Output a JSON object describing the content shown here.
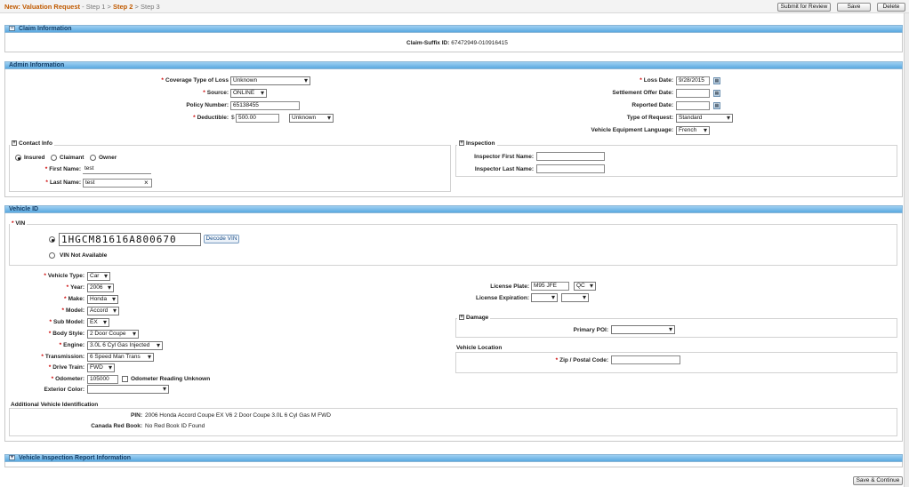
{
  "header": {
    "title": "New: Valuation Request",
    "sep1": " - ",
    "step1": "Step 1",
    "arrow1": " > ",
    "step2": "Step 2",
    "arrow2": " > ",
    "step3": "Step 3",
    "submit_label": "Submit for Review",
    "save_label": "Save",
    "delete_label": "Delete"
  },
  "claim": {
    "title": "Claim Information",
    "toggle": "−",
    "suffix_label": "Claim-Suffix ID:",
    "suffix_value": "67472949-010916415"
  },
  "admin": {
    "title": "Admin Information",
    "coverage_label": "Coverage Type of Loss",
    "coverage_value": "Unknown",
    "source_label": "Source:",
    "source_value": "ONLINE",
    "policy_label": "Policy Number:",
    "policy_value": "65138455",
    "deductible_label": "Deductible:",
    "currency": "$",
    "deductible_value": "500.00",
    "deductible_type": "Unknown",
    "loss_date_label": "Loss Date:",
    "loss_date_value": "9/28/2015",
    "settlement_label": "Settlement Offer Date:",
    "settlement_value": "",
    "reported_label": "Reported Date:",
    "reported_value": "",
    "request_type_label": "Type of Request:",
    "request_type_value": "Standard",
    "equipment_lang_label": "Vehicle Equipment Language:",
    "equipment_lang_value": "French",
    "cal_icon": "▦"
  },
  "contact": {
    "legend": "Contact Info",
    "insured": "Insured",
    "claimant": "Claimant",
    "owner": "Owner",
    "first_name_label": "First Name:",
    "first_name_value": "test",
    "last_name_label": "Last Name:",
    "last_name_value": "test",
    "clear_icon": "×"
  },
  "inspection": {
    "legend": "Inspection",
    "first_name_label": "Inspector First Name:",
    "first_name_value": "",
    "last_name_label": "Inspector Last Name:",
    "last_name_value": ""
  },
  "vehicle": {
    "title": "Vehicle ID",
    "vin_legend": "VIN",
    "vin_value": "1HGCM81616A800670",
    "decode_label": "Decode VIN",
    "vin_na_label": "VIN Not Available",
    "type_label": "Vehicle Type:",
    "type_value": "Car",
    "year_label": "Year:",
    "year_value": "2006",
    "make_label": "Make:",
    "make_value": "Honda",
    "model_label": "Model:",
    "model_value": "Accord",
    "submodel_label": "Sub Model:",
    "submodel_value": "EX",
    "body_label": "Body Style:",
    "body_value": "2 Door Coupe",
    "engine_label": "Engine:",
    "engine_value": "3.0L 6 Cyl Gas Injected",
    "transmission_label": "Transmission:",
    "transmission_value": "6 Speed Man Trans",
    "drivetrain_label": "Drive Train:",
    "drivetrain_value": "FWD",
    "odometer_label": "Odometer:",
    "odometer_value": "105000",
    "odometer_unknown_label": "Odometer Reading Unknown",
    "exterior_label": "Exterior Color:",
    "exterior_value": "",
    "plate_label": "License Plate:",
    "plate_value": "M95 JFE",
    "plate_province": "QC",
    "expiration_label": "License Expiration:",
    "expiration_month": "",
    "expiration_year": "",
    "damage_legend": "Damage",
    "poi_label": "Primary POI:",
    "poi_value": "",
    "location_title": "Vehicle Location",
    "zip_label": "Zip / Postal Code:",
    "zip_value": "",
    "additional_title": "Additional Vehicle Identification",
    "pin_label": "PIN:",
    "pin_value": "2006 Honda Accord Coupe EX V6 2 Door Coupe 3.0L 6 Cyl Gas M FWD",
    "redbook_label": "Canada Red Book:",
    "redbook_value": "No Red Book ID Found"
  },
  "inspection_report": {
    "title": "Vehicle Inspection Report Information",
    "toggle": "+"
  },
  "footer": {
    "save_continue_label": "Save & Continue"
  },
  "req_mark": "*",
  "plus_mark": "+"
}
